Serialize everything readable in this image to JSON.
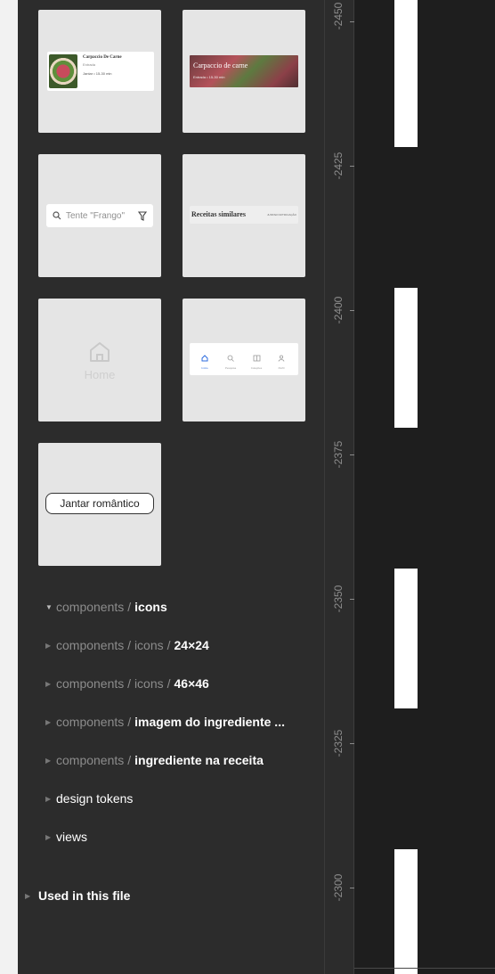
{
  "ruler": {
    "ticks": [
      "-2450",
      "-2425",
      "-2400",
      "-2375",
      "-2350",
      "-2325",
      "-2300"
    ]
  },
  "thumbs": {
    "card1": {
      "title": "Carpaccio De Carne",
      "subtitle": "Entrada",
      "meta": "Jantar • 15-30 min"
    },
    "card2": {
      "title": "Carpaccio de carne",
      "meta": "Entrada • 15-30 min"
    },
    "search": {
      "placeholder": "Tente \"Frango\""
    },
    "similar": {
      "title": "Receitas similares",
      "link": "JUNTAR NOTIFICAÇÃO"
    },
    "home": {
      "label": "Home"
    },
    "nav": {
      "items": [
        "Início",
        "Pesquisa",
        "Coleções",
        "Perfil"
      ]
    },
    "chip": {
      "label": "Jantar romântico"
    }
  },
  "tree": {
    "rows": [
      {
        "prefix": "components",
        "name": "icons",
        "expanded": true
      },
      {
        "prefix": "components / icons",
        "name": "24×24",
        "expanded": false
      },
      {
        "prefix": "components / icons",
        "name": "46×46",
        "expanded": false
      },
      {
        "prefix": "components",
        "name": "imagem do ingrediente ...",
        "expanded": false
      },
      {
        "prefix": "components",
        "name": "ingrediente na receita",
        "expanded": false
      }
    ],
    "design_tokens": "design tokens",
    "views": "views",
    "used_in_file": "Used in this file"
  }
}
